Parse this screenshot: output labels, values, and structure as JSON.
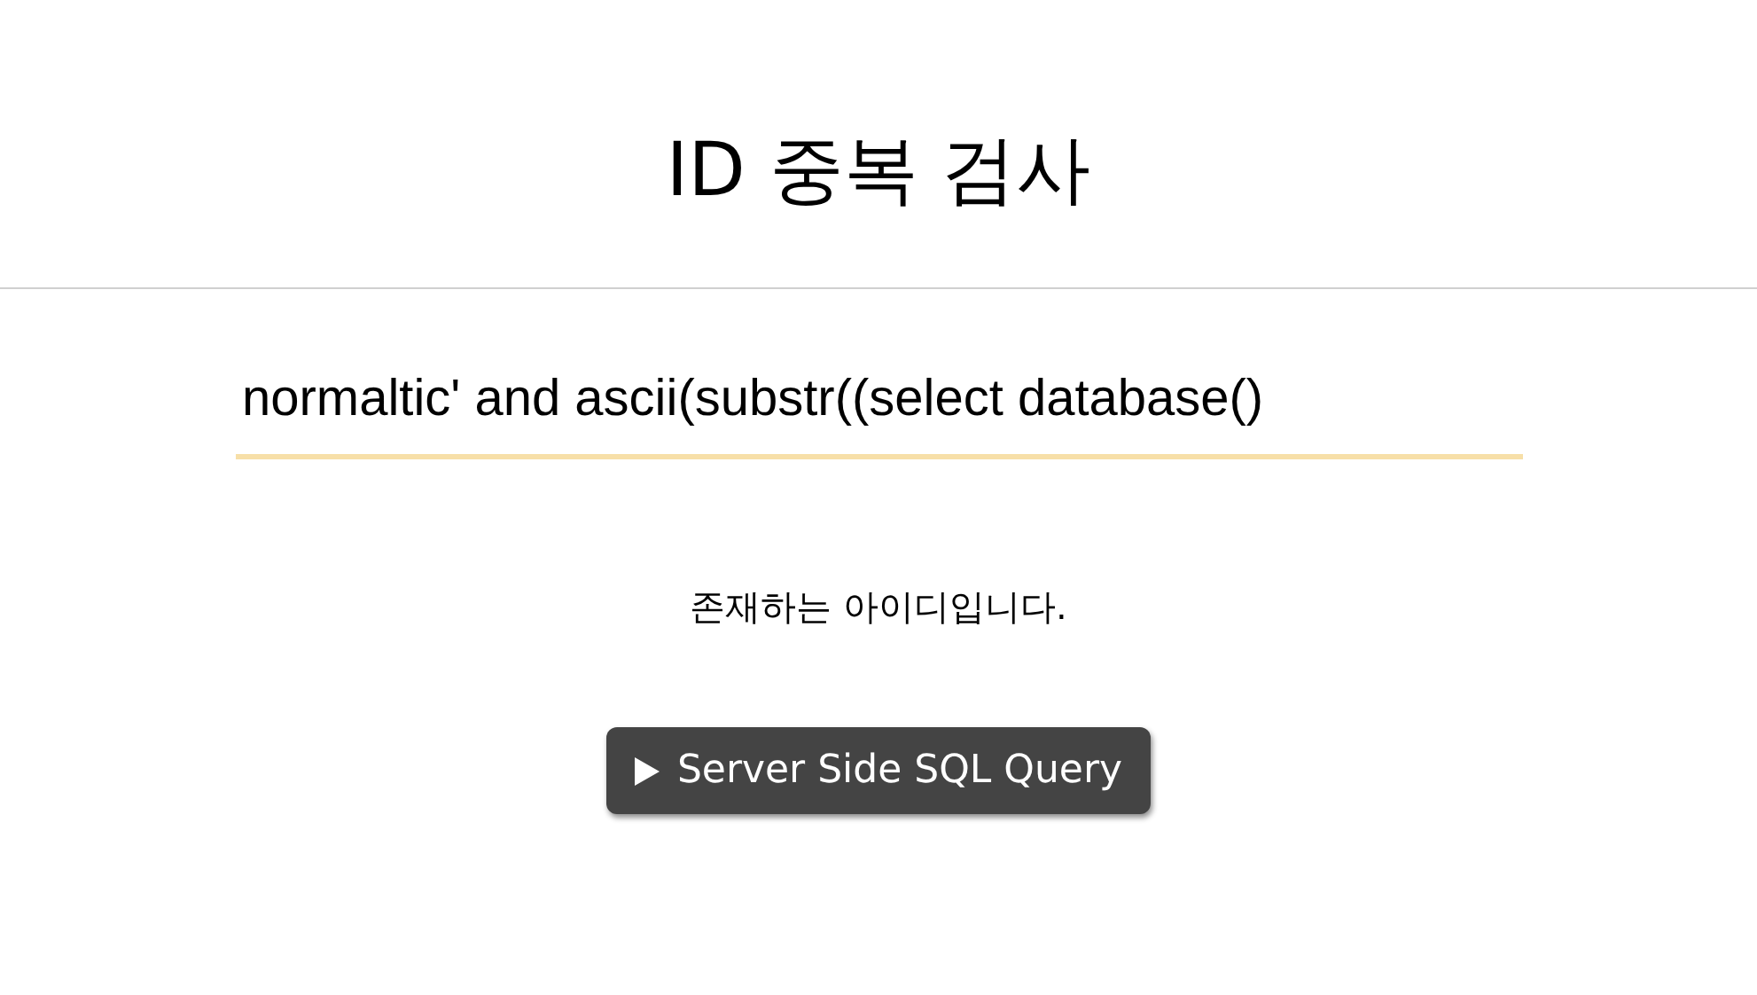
{
  "title": "ID 중복 검사",
  "id_field": {
    "value": "normaltic' and ascii(substr((select database()"
  },
  "message": "존재하는 아이디입니다.",
  "button": {
    "label": "Server Side SQL Query"
  }
}
